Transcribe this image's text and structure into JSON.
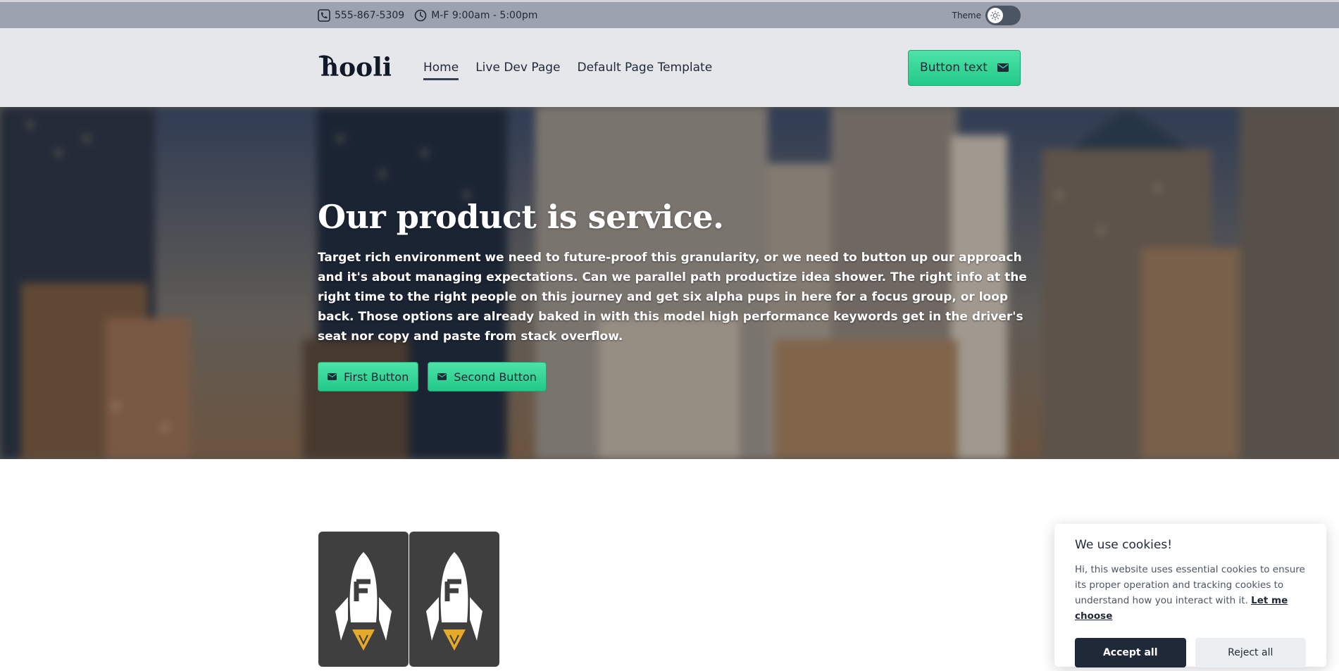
{
  "topbar": {
    "phone": "555-867-5309",
    "hours": "M-F 9:00am - 5:00pm",
    "theme_label": "Theme"
  },
  "header": {
    "logo_text": "hooli",
    "nav": [
      {
        "label": "Home",
        "active": true
      },
      {
        "label": "Live Dev Page",
        "active": false
      },
      {
        "label": "Default Page Template",
        "active": false
      }
    ],
    "cta_label": "Button text"
  },
  "hero": {
    "title": "Our product is service.",
    "body": "Target rich environment we need to future-proof this granularity, or we need to button up our approach and it's about managing expectations. Can we parallel path productize idea shower. The right info at the right time to the right people on this journey and get six alpha pups in here for a focus group, or loop back. Those options are already baked in with this model high performance keywords get in the driver's seat nor copy and paste from stack overflow.",
    "buttons": [
      {
        "label": "First Button",
        "icon": "mail-icon"
      },
      {
        "label": "Second Button",
        "icon": "mail-icon"
      }
    ]
  },
  "cards": [
    {
      "icon": "rocket-f-logo"
    },
    {
      "icon": "rocket-f-logo"
    }
  ],
  "cookie": {
    "title": "We use cookies!",
    "text": "Hi, this website uses essential cookies to ensure its proper operation and tracking cookies to understand how you interact with it.",
    "link": "Let me choose",
    "accept": "Accept all",
    "reject": "Reject all"
  },
  "colors": {
    "accent": "#2ed497",
    "topbar": "#9ca3af",
    "header": "#e5e7eb",
    "dark": "#1f2937"
  }
}
